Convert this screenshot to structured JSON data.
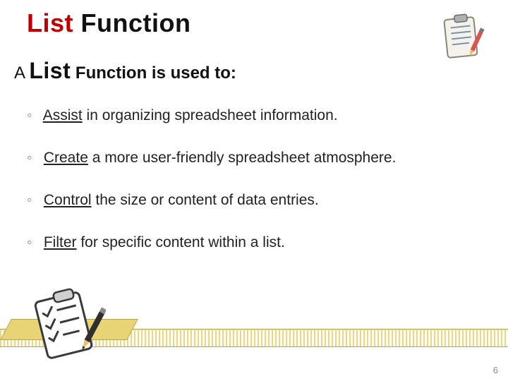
{
  "title": {
    "word1": "List",
    "word2": "Function"
  },
  "subtitle": {
    "prefix": "A ",
    "big": "List",
    "rest": " Function is used to:"
  },
  "bullets": [
    {
      "keyword": "Assist",
      "rest": " in organizing spreadsheet information."
    },
    {
      "keyword": "Create",
      "rest": " a more user-friendly spreadsheet atmosphere."
    },
    {
      "keyword": "Control",
      "rest": " the size or content of data entries."
    },
    {
      "keyword": "Filter",
      "rest": " for specific content within a list."
    }
  ],
  "bullet_marker": "◦",
  "page_number": "6",
  "colors": {
    "accent_red": "#c00000",
    "hatch": "#f0d87a"
  }
}
